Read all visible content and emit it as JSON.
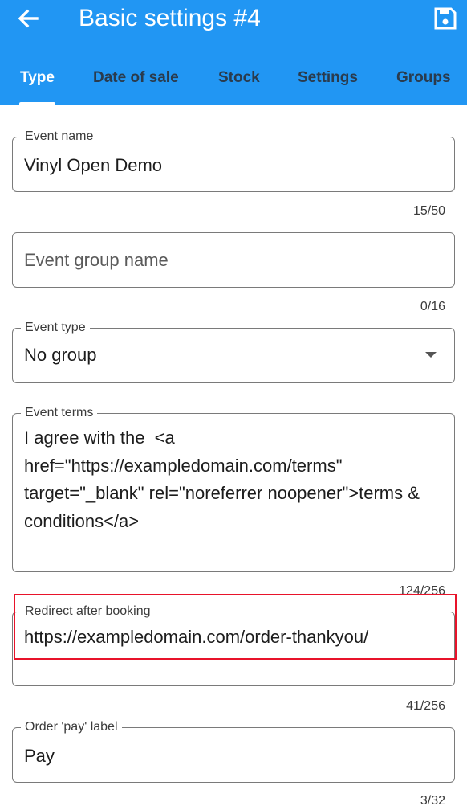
{
  "appbar": {
    "title": "Basic settings #4",
    "back_icon": "arrow-left-icon",
    "save_icon": "floppy-disk-icon",
    "background": "#2196f3"
  },
  "tabs": [
    {
      "label": "Type",
      "active": true
    },
    {
      "label": "Date of sale",
      "active": false
    },
    {
      "label": "Stock",
      "active": false
    },
    {
      "label": "Settings",
      "active": false
    },
    {
      "label": "Groups",
      "active": false
    }
  ],
  "fields": {
    "event_name": {
      "label": "Event name",
      "value": "Vinyl Open Demo",
      "counter": "15/50"
    },
    "event_group_name": {
      "placeholder": "Event group name",
      "counter": "0/16"
    },
    "event_type": {
      "label": "Event type",
      "value": "No group"
    },
    "event_terms": {
      "label": "Event terms",
      "value": "I agree with the  <a href=\"https://exampledomain.com/terms\" target=\"_blank\" rel=\"noreferrer noopener\">terms & conditions</a>",
      "counter": "124/256"
    },
    "redirect": {
      "label": "Redirect after booking",
      "value": "https://exampledomain.com/order-thankyou/",
      "counter": "41/256"
    },
    "pay_label": {
      "label": "Order 'pay' label",
      "value": "Pay",
      "counter": "3/32"
    }
  },
  "highlight_color": "#e8132a"
}
